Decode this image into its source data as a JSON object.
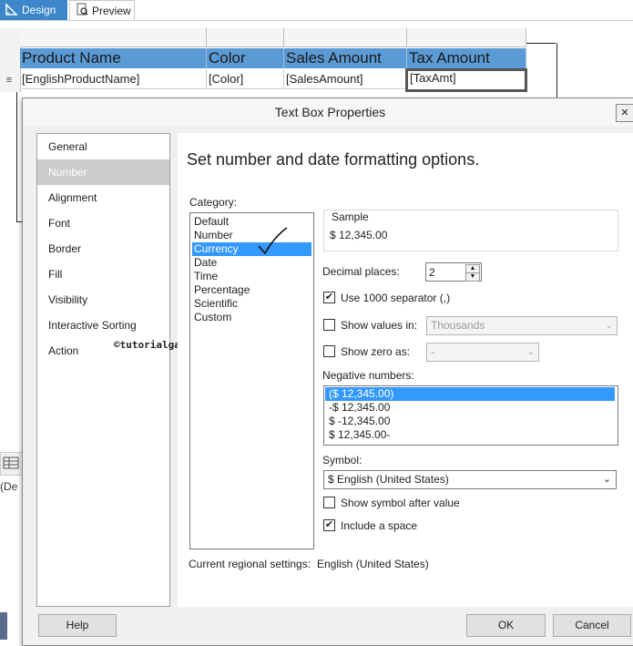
{
  "designer": {
    "tabs": [
      {
        "label": "Design"
      },
      {
        "label": "Preview"
      }
    ]
  },
  "report": {
    "headers": [
      "Product Name",
      "Color",
      "Sales Amount",
      "Tax Amount"
    ],
    "cells": [
      "[EnglishProductName]",
      "[Color]",
      "[SalesAmount]",
      "[TaxAmt]"
    ],
    "row_menu_glyph": "≡",
    "side_fragment": "(De"
  },
  "dialog": {
    "title": "Text Box Properties",
    "nav": [
      "General",
      "Number",
      "Alignment",
      "Font",
      "Border",
      "Fill",
      "Visibility",
      "Interactive Sorting",
      "Action"
    ],
    "watermark": "©tutorialgateway.org",
    "heading": "Set number and date formatting options.",
    "category_label": "Category:",
    "categories": [
      "Default",
      "Number",
      "Currency",
      "Date",
      "Time",
      "Percentage",
      "Scientific",
      "Custom"
    ],
    "sample_label": "Sample",
    "sample_value": "$ 12,345.00",
    "decimal_label": "Decimal places:",
    "decimal_value": "2",
    "use_separator_label": "Use 1000 separator (,)",
    "show_values_label": "Show values in:",
    "show_values_value": "Thousands",
    "show_zero_label": "Show zero as:",
    "show_zero_value": "-",
    "negative_label": "Negative numbers:",
    "negatives": [
      "($ 12,345.00)",
      "-$ 12,345.00",
      "$ -12,345.00",
      "$ 12,345.00-"
    ],
    "symbol_label": "Symbol:",
    "symbol_value": "$ English (United States)",
    "show_symbol_after_label": "Show symbol after value",
    "include_space_label": "Include a space",
    "regional_label": "Current regional settings:",
    "regional_value": "English (United States)",
    "help_label": "Help",
    "ok_label": "OK",
    "cancel_label": "Cancel",
    "check_glyph": "✔"
  },
  "colors": {
    "accent": "#3c86c9",
    "header_fill": "#5b9bd5",
    "selection": "#3399ff"
  }
}
